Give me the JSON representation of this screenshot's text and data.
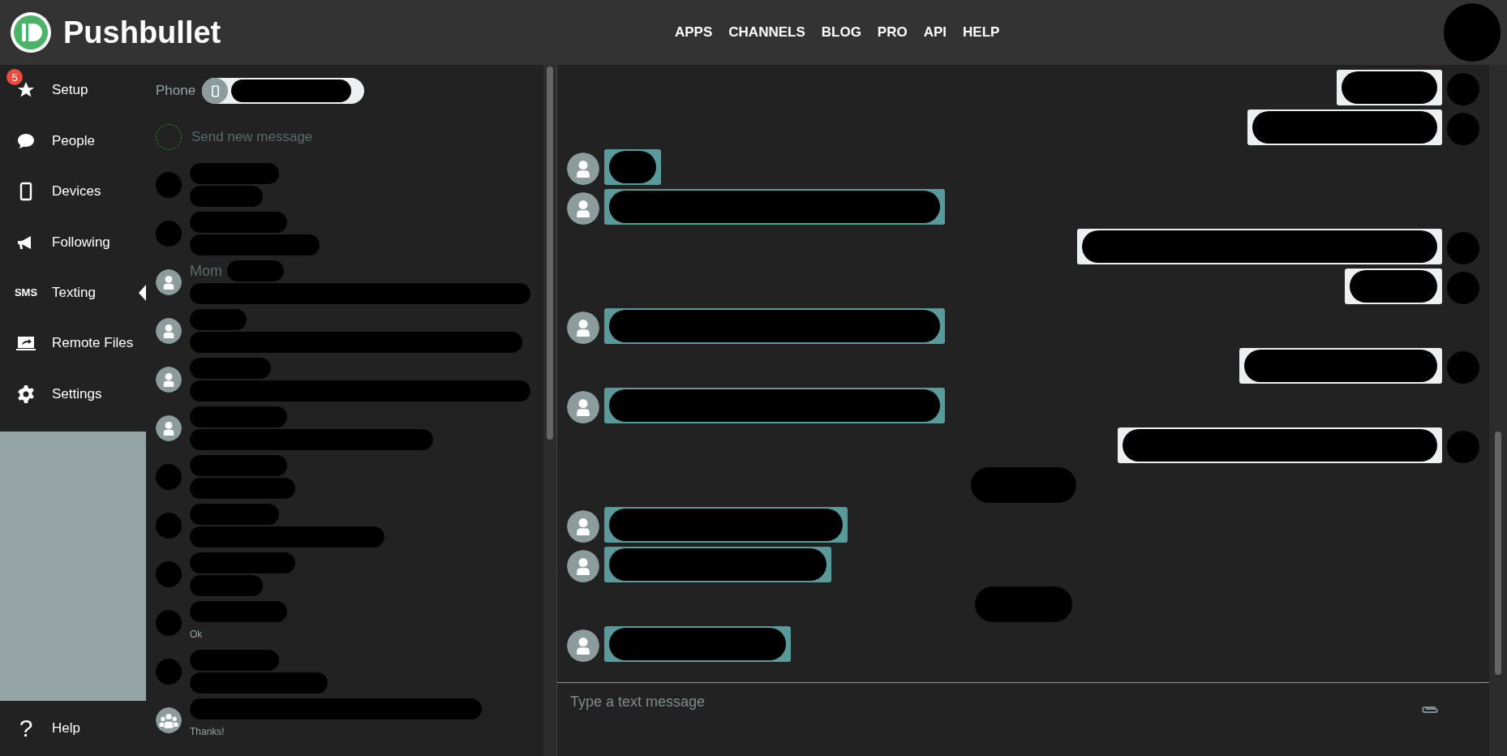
{
  "header": {
    "brand": "Pushbullet",
    "nav": [
      "APPS",
      "CHANNELS",
      "BLOG",
      "PRO",
      "API",
      "HELP"
    ]
  },
  "sidebar": {
    "items": [
      {
        "kind": "star",
        "label": "Setup",
        "badge": "5",
        "selected": false
      },
      {
        "kind": "bubble",
        "label": "People",
        "selected": false
      },
      {
        "kind": "phone",
        "label": "Devices",
        "selected": false
      },
      {
        "kind": "megaphone",
        "label": "Following",
        "selected": false
      },
      {
        "kind": "sms",
        "label": "Texting",
        "icon_text": "SMS",
        "selected": true
      },
      {
        "kind": "laptop",
        "label": "Remote Files",
        "selected": false
      },
      {
        "kind": "gear",
        "label": "Settings",
        "selected": false
      }
    ],
    "help": {
      "icon_text": "?",
      "label": "Help"
    }
  },
  "threads": {
    "device_label": "Phone",
    "new_message": "Send new message",
    "items": [
      {
        "kind": "redacted"
      },
      {
        "kind": "redacted"
      },
      {
        "kind": "person",
        "name": "Mom"
      },
      {
        "kind": "person"
      },
      {
        "kind": "person"
      },
      {
        "kind": "person"
      },
      {
        "kind": "redacted"
      },
      {
        "kind": "redacted"
      },
      {
        "kind": "redacted"
      },
      {
        "kind": "redacted",
        "preview": "Ok"
      },
      {
        "kind": "redacted"
      },
      {
        "kind": "group",
        "preview": "Thanks!"
      }
    ]
  },
  "chat": {
    "messages": [
      {
        "kind": "outgoing"
      },
      {
        "kind": "outgoing"
      },
      {
        "kind": "incoming"
      },
      {
        "kind": "incoming"
      },
      {
        "kind": "outgoing"
      },
      {
        "kind": "outgoing"
      },
      {
        "kind": "incoming"
      },
      {
        "kind": "outgoing"
      },
      {
        "kind": "incoming"
      },
      {
        "kind": "outgoing"
      },
      {
        "kind": "timestamp"
      },
      {
        "kind": "incoming"
      },
      {
        "kind": "incoming"
      },
      {
        "kind": "timestamp"
      },
      {
        "kind": "incoming"
      }
    ],
    "input": {
      "placeholder": "Type a text message"
    }
  }
}
